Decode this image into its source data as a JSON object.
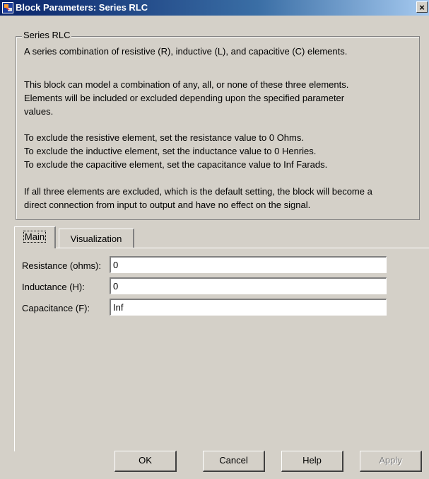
{
  "window": {
    "title": "Block Parameters: Series RLC",
    "app_icon": "simulink-block-icon",
    "close_label": "×"
  },
  "group": {
    "label": "Series RLC",
    "lines": [
      "A series combination of resistive (R), inductive (L), and capacitive (C) elements.",
      "This block can model a combination of any, all, or none of these three elements.",
      "Elements will be included or excluded depending upon the specified parameter",
      "values.",
      "To exclude  the resistive element, set the resistance value to 0 Ohms.",
      "To exclude  the inductive element, set the inductance value to 0 Henries.",
      "To exclude the capacitive element, set the capacitance value to Inf Farads.",
      "If all three elements are excluded, which is the default setting, the block will become a",
      "direct connection from input to output and have no effect on the signal."
    ]
  },
  "tabs": [
    {
      "label": "Main",
      "active": true
    },
    {
      "label": "Visualization",
      "active": false
    }
  ],
  "params": [
    {
      "label": "Resistance (ohms):",
      "value": "0"
    },
    {
      "label": "Inductance (H):",
      "value": "0"
    },
    {
      "label": "Capacitance (F):",
      "value": "Inf"
    }
  ],
  "buttons": {
    "ok": "OK",
    "cancel": "Cancel",
    "help": "Help",
    "apply": "Apply"
  },
  "colors": {
    "titlebar_start": "#0a246a",
    "titlebar_end": "#a6caf0",
    "dialog_bg": "#d4d0c8"
  }
}
